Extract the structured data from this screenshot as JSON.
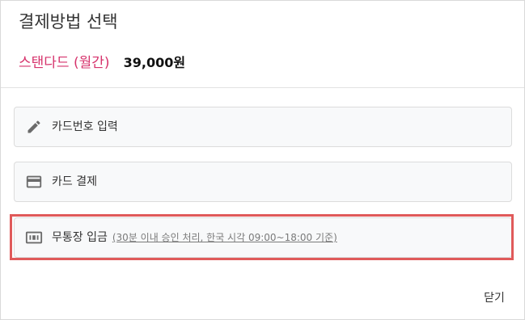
{
  "modal": {
    "title": "결제방법 선택",
    "plan_name": "스탠다드 (월간)",
    "plan_price": "39,000원"
  },
  "methods": [
    {
      "label": "카드번호 입력",
      "icon": "pencil-icon",
      "note": ""
    },
    {
      "label": "카드 결제",
      "icon": "credit-card-icon",
      "note": ""
    },
    {
      "label": "무통장 입금",
      "icon": "bank-transfer-icon",
      "note": "(30분 이내 승인 처리, 한국 시각 09:00~18:00 기준)"
    }
  ],
  "footer": {
    "close_label": "닫기"
  },
  "colors": {
    "plan_accent": "#d6336c",
    "highlight": "#e05a5a"
  }
}
